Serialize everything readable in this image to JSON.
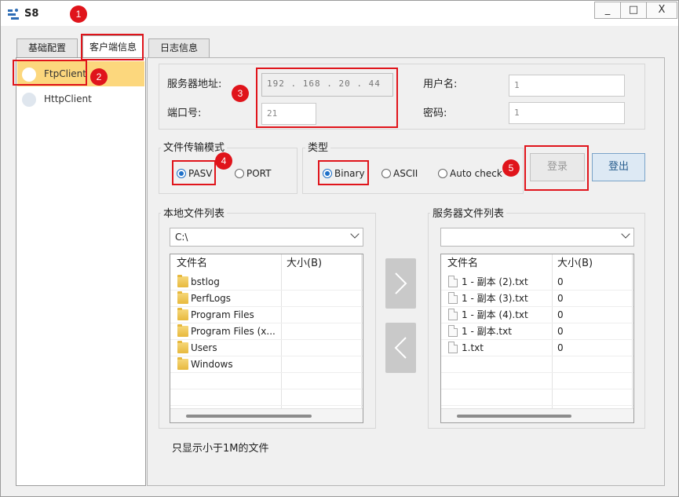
{
  "window": {
    "title": "S8",
    "minimize": "_",
    "maximize": "□",
    "close": "X"
  },
  "tabs": [
    {
      "label": "基础配置"
    },
    {
      "label": "客户端信息"
    },
    {
      "label": "日志信息"
    }
  ],
  "sidebar": {
    "items": [
      {
        "label": "FtpClient"
      },
      {
        "label": "HttpClient"
      }
    ]
  },
  "server": {
    "address_label": "服务器地址:",
    "address_value": "192 . 168 . 20 . 44",
    "port_label": "端口号:",
    "port_value": "21",
    "user_label": "用户名:",
    "user_value": "1",
    "password_label": "密码:",
    "password_value": "1"
  },
  "transfer_mode": {
    "title": "文件传输模式",
    "options": [
      "PASV",
      "PORT"
    ],
    "selected": "PASV"
  },
  "type": {
    "title": "类型",
    "options": [
      "Binary",
      "ASCII",
      "Auto check"
    ],
    "selected": "Binary"
  },
  "buttons": {
    "login": "登录",
    "logout": "登出"
  },
  "local_files": {
    "title": "本地文件列表",
    "path": "C:\\",
    "columns": [
      "文件名",
      "大小(B)"
    ],
    "rows": [
      {
        "name": "bstlog",
        "size": ""
      },
      {
        "name": "PerfLogs",
        "size": ""
      },
      {
        "name": "Program Files",
        "size": ""
      },
      {
        "name": "Program Files (x...",
        "size": ""
      },
      {
        "name": "Users",
        "size": ""
      },
      {
        "name": "Windows",
        "size": ""
      }
    ]
  },
  "server_files": {
    "title": "服务器文件列表",
    "path": "",
    "columns": [
      "文件名",
      "大小(B)"
    ],
    "rows": [
      {
        "name": "1 - 副本 (2).txt",
        "size": "0"
      },
      {
        "name": "1 - 副本 (3).txt",
        "size": "0"
      },
      {
        "name": "1 - 副本 (4).txt",
        "size": "0"
      },
      {
        "name": "1 - 副本.txt",
        "size": "0"
      },
      {
        "name": "1.txt",
        "size": "0"
      }
    ]
  },
  "note": "只显示小于1M的文件",
  "annotations": [
    "1",
    "2",
    "3",
    "4",
    "5"
  ],
  "colors": {
    "annotation": "#e0141b",
    "selected_row": "#fcd77d",
    "radio_on": "#1e70c8"
  }
}
